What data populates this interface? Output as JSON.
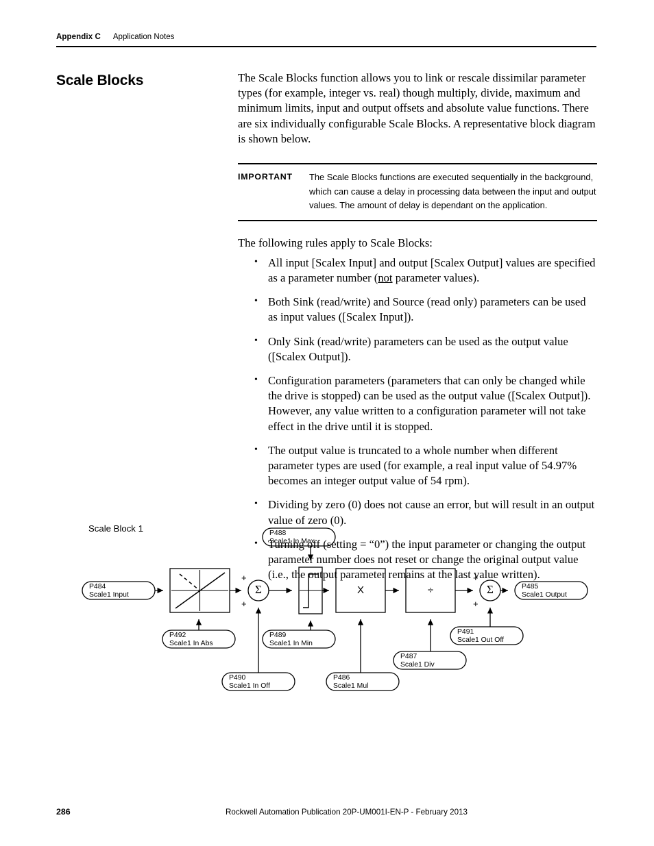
{
  "header": {
    "appendix": "Appendix C",
    "subtitle": "Application Notes"
  },
  "section": {
    "title": "Scale Blocks"
  },
  "intro": {
    "paragraph": "The Scale Blocks function allows you to link or rescale dissimilar parameter types (for example, integer vs. real) though multiply, divide, maximum and minimum limits, input and output offsets and absolute value functions. There are six individually configurable Scale Blocks. A representative block diagram is shown below."
  },
  "important": {
    "label": "IMPORTANT",
    "text": "The Scale Blocks functions are executed sequentially in the background, which can cause a delay in processing data between the input and output values. The amount of delay is dependant on the application."
  },
  "rules": {
    "intro": "The following rules apply to Scale Blocks:",
    "items": [
      {
        "pre": "All input [Scalex Input] and output [Scalex Output] values are specified as a parameter number (",
        "underline": "not",
        "post": " parameter values)."
      },
      {
        "pre": "Both Sink (read/write) and Source (read only) parameters can be used as input values ([Scalex Input]).",
        "underline": "",
        "post": ""
      },
      {
        "pre": "Only Sink (read/write) parameters can be used as the output value ([Scalex Output]).",
        "underline": "",
        "post": ""
      },
      {
        "pre": "Configuration parameters (parameters that can only be changed while the drive is stopped) can be used as the output value ([Scalex Output]). However, any value written to a configuration parameter will not take effect in the drive until it is stopped.",
        "underline": "",
        "post": ""
      },
      {
        "pre": "The output value is truncated to a whole number when different parameter types are used (for example, a real input value of 54.97% becomes an integer output value of 54 rpm).",
        "underline": "",
        "post": ""
      },
      {
        "pre": "Dividing by zero (0) does not cause an error, but will result in an output value of zero (0).",
        "underline": "",
        "post": ""
      },
      {
        "pre": "Turning off (setting = “0”) the input parameter or changing the output parameter number does not reset or change the original output value (i.e., the output parameter remains at the last value written).",
        "underline": "",
        "post": ""
      }
    ]
  },
  "diagram": {
    "caption": "Scale Block 1",
    "pills": {
      "input": {
        "param": "P484",
        "name": "Scale1 Input"
      },
      "in_abs": {
        "param": "P492",
        "name": "Scale1 In Abs"
      },
      "in_off": {
        "param": "P490",
        "name": "Scale1 In Off"
      },
      "in_max": {
        "param": "P488",
        "name": "Scale1 In Max"
      },
      "in_min": {
        "param": "P489",
        "name": "Scale1 In Min"
      },
      "mul": {
        "param": "P486",
        "name": "Scale1 Mul"
      },
      "div": {
        "param": "P487",
        "name": "Scale1 Div"
      },
      "out_off": {
        "param": "P491",
        "name": "Scale1 Out Off"
      },
      "output": {
        "param": "P485",
        "name": "Scale1 Output"
      }
    },
    "blocks": {
      "multiply_glyph": "X",
      "divide_glyph": "÷",
      "sum_glyph": "Σ",
      "plus_sign": "+"
    }
  },
  "footer": {
    "page_number": "286",
    "publication": "Rockwell Automation Publication 20P-UM001I-EN-P - February 2013"
  }
}
